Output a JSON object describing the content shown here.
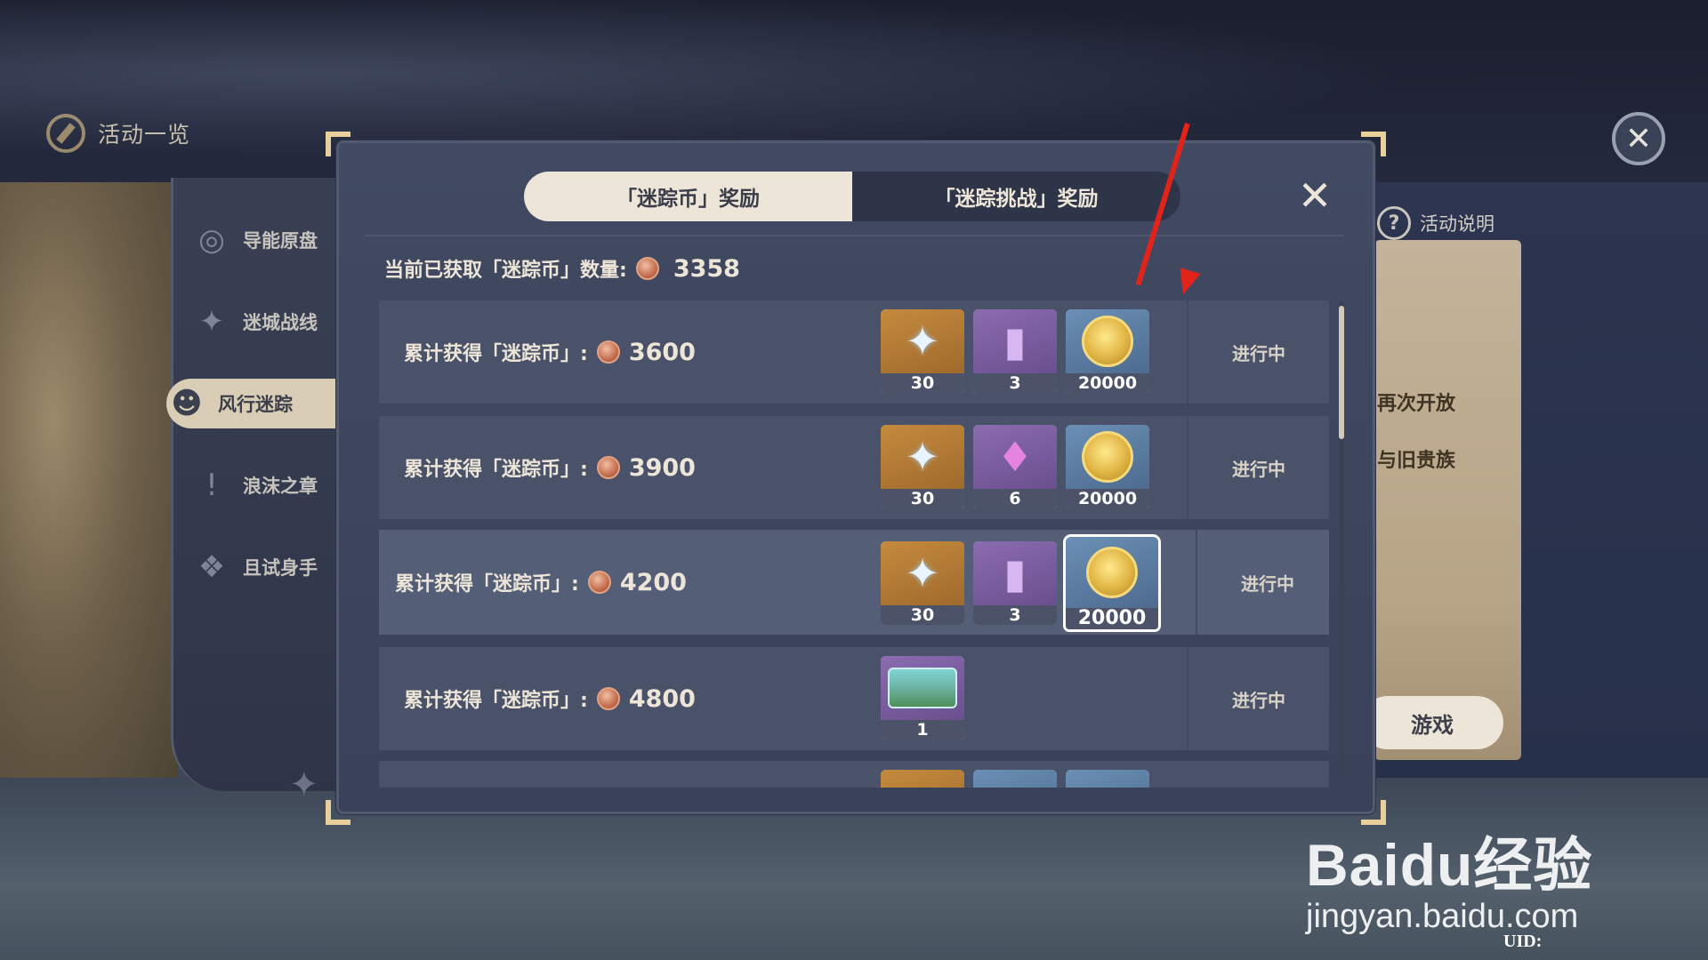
{
  "top_bar": {
    "title": "活动一览"
  },
  "sidebar": {
    "items": [
      {
        "label": "导能原盘",
        "icon": "disc-icon"
      },
      {
        "label": "迷城战线",
        "icon": "crest-icon"
      },
      {
        "label": "风行迷踪",
        "icon": "cat-mask-icon",
        "active": true
      },
      {
        "label": "浪沫之章",
        "icon": "exclamation-icon"
      },
      {
        "label": "且试身手",
        "icon": "cards-icon"
      }
    ]
  },
  "right_panel": {
    "help_label": "活动说明",
    "text1": "再次开放",
    "text2": "与旧贵族",
    "button_label": "游戏"
  },
  "modal": {
    "tabs": [
      {
        "label": "「迷踪币」奖励",
        "active": true
      },
      {
        "label": "「迷踪挑战」奖励",
        "active": false
      }
    ],
    "current_label": "当前已获取「迷踪币」数量:",
    "current_value": "3358",
    "rows": [
      {
        "label": "累计获得「迷踪币」:",
        "amount": "3600",
        "status": "进行中",
        "rewards": [
          {
            "icon": "primogem-icon",
            "qty": "30",
            "rarity": "gold"
          },
          {
            "icon": "talent-book-icon",
            "qty": "3",
            "rarity": "purple"
          },
          {
            "icon": "mora-icon",
            "qty": "20000",
            "rarity": "blue"
          }
        ]
      },
      {
        "label": "累计获得「迷踪币」:",
        "amount": "3900",
        "status": "进行中",
        "rewards": [
          {
            "icon": "primogem-icon",
            "qty": "30",
            "rarity": "gold"
          },
          {
            "icon": "crystal-icon",
            "qty": "6",
            "rarity": "purple"
          },
          {
            "icon": "mora-icon",
            "qty": "20000",
            "rarity": "blue"
          }
        ]
      },
      {
        "label": "累计获得「迷踪币」:",
        "amount": "4200",
        "status": "进行中",
        "rewards": [
          {
            "icon": "primogem-icon",
            "qty": "30",
            "rarity": "gold"
          },
          {
            "icon": "talent-book-icon",
            "qty": "3",
            "rarity": "purple"
          },
          {
            "icon": "mora-icon",
            "qty": "20000",
            "rarity": "blue",
            "selected": true
          }
        ]
      },
      {
        "label": "累计获得「迷踪币」:",
        "amount": "4800",
        "status": "进行中",
        "rewards": [
          {
            "icon": "landscape-card-icon",
            "qty": "1",
            "rarity": "purple"
          }
        ]
      }
    ]
  },
  "watermark": {
    "logo": "Baidu经验",
    "url": "jingyan.baidu.com"
  },
  "uid_label": "UID:"
}
